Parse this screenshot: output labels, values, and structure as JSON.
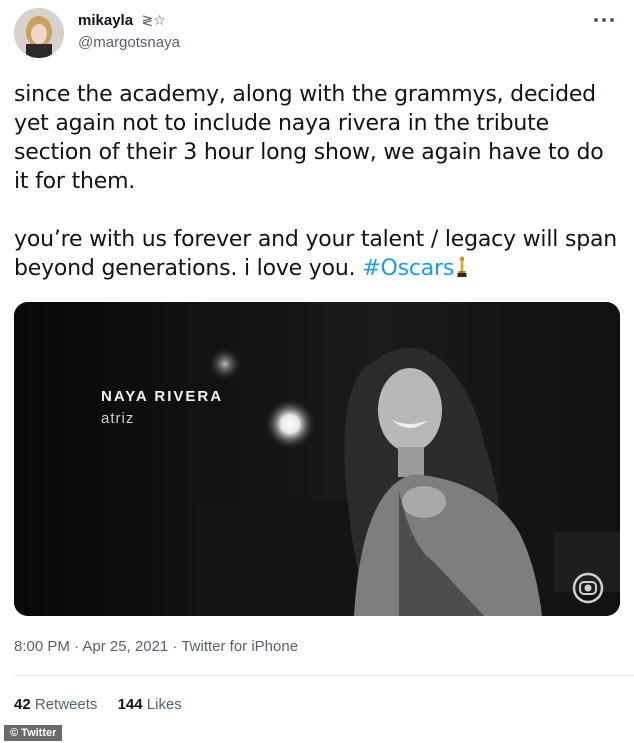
{
  "user": {
    "display_name": "mikayla",
    "name_emoji": "≷☆",
    "handle": "@margotsnaya"
  },
  "tweet": {
    "paragraph1": "since the academy, along with the grammys, decided yet again not to include naya rivera in the tribute section of their 3 hour long show, we again have to do it for them.",
    "paragraph2_text": "you’re with us forever and your talent / legacy will span beyond generations. i love you. ",
    "hashtag": "#Oscars",
    "trailing_emoji": "oscar-trophy-emoji"
  },
  "media": {
    "overlay_name": "NAYA RIVERA",
    "overlay_role": "atriz",
    "watermark": "globo-logo-icon"
  },
  "meta": {
    "timestamp": "8:00 PM · Apr 25, 2021 · Twitter for iPhone"
  },
  "stats": {
    "retweets_count": "42",
    "retweets_label": "Retweets",
    "likes_count": "144",
    "likes_label": "Likes"
  },
  "credit": {
    "label": "© Twitter"
  },
  "colors": {
    "hashtag": "#1d9bf0",
    "secondary_text": "#536471",
    "primary_text": "#0f1419"
  }
}
